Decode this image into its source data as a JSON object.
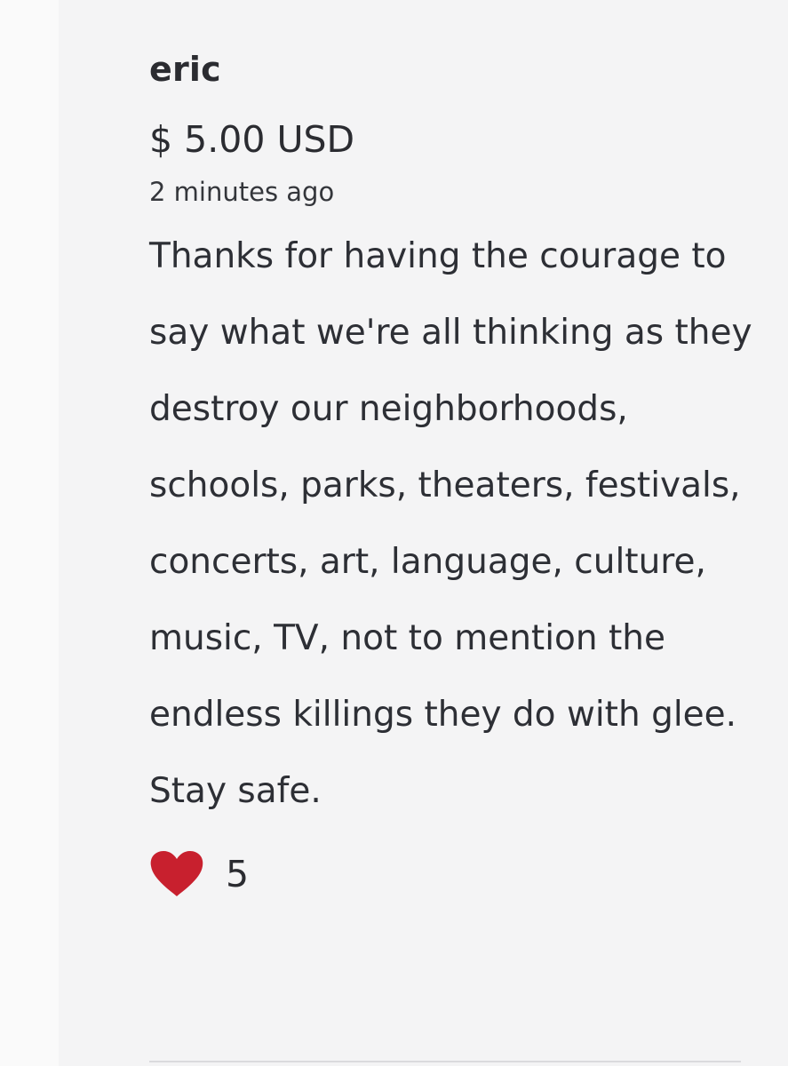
{
  "donation": {
    "donor_name": "eric",
    "amount": "$ 5.00 USD",
    "time_ago": "2 minutes ago",
    "message": "Thanks for having the courage to say what we're all thinking as they destroy our neighborhoods, schools, parks, theaters, festivals, concerts, art, language, culture, music, TV, not to mention the endless killings they do with glee. Stay safe.",
    "like_count": "5",
    "like_icon": "heart-icon"
  },
  "colors": {
    "heart": "#c8202e",
    "panel_background": "#f4f4f5",
    "text": "#2b2c31"
  }
}
